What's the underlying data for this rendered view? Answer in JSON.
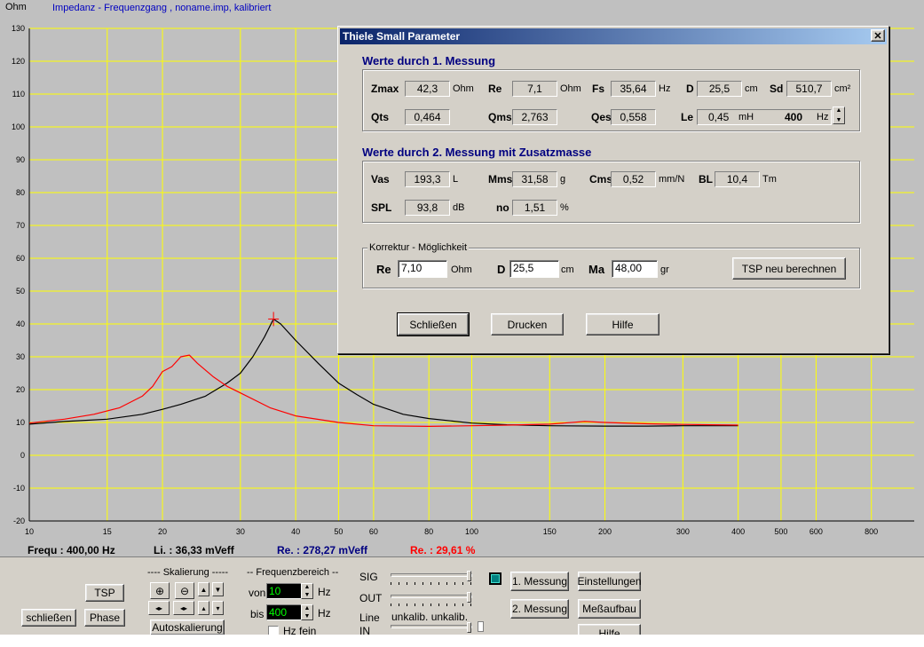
{
  "plot": {
    "y_unit": "Ohm",
    "title": "Impedanz - Frequenzgang , noname.imp, kalibriert",
    "y_ticks": [
      130,
      120,
      110,
      100,
      90,
      80,
      70,
      60,
      50,
      40,
      30,
      20,
      10,
      0,
      -10,
      -20
    ],
    "x_ticks": [
      10,
      15,
      20,
      30,
      40,
      50,
      60,
      80,
      100,
      150,
      200,
      300,
      400,
      500,
      600,
      800
    ],
    "colors": {
      "background": "#c0c0c0",
      "grid": "#ffff00",
      "axis": "#000000",
      "curve_black": "#000000",
      "curve_red": "#ff0000"
    }
  },
  "chart_data": {
    "type": "line",
    "x_scale": "log",
    "xlim": [
      10,
      1000
    ],
    "ylim": [
      -20,
      130
    ],
    "series": [
      {
        "color": "#000000",
        "x": [
          10,
          12,
          15,
          18,
          20,
          22,
          25,
          28,
          30,
          32,
          34,
          35.64,
          37,
          40,
          45,
          50,
          55,
          60,
          70,
          80,
          100,
          120,
          150,
          200,
          250,
          300,
          400
        ],
        "y": [
          9.5,
          10.3,
          11,
          12.5,
          14,
          15.5,
          18,
          22,
          25,
          30,
          36,
          41.5,
          40,
          35,
          28,
          22,
          18.5,
          15.5,
          12.5,
          11.2,
          9.8,
          9.3,
          9,
          8.9,
          8.9,
          9,
          9
        ]
      },
      {
        "color": "#ff0000",
        "x": [
          10,
          12,
          14,
          16,
          18,
          19,
          20,
          21,
          22,
          23,
          24,
          26,
          28,
          30,
          35,
          40,
          50,
          60,
          80,
          100,
          120,
          150,
          180,
          200,
          250,
          300,
          400
        ],
        "y": [
          9.8,
          11,
          12.5,
          14.5,
          18,
          21,
          25.5,
          27,
          30,
          30.5,
          28,
          24,
          21,
          19,
          14.5,
          12,
          10,
          9,
          8.8,
          9,
          9.2,
          9.5,
          10.3,
          10,
          9.6,
          9.4,
          9.2
        ]
      }
    ],
    "marker": {
      "x": 35.64,
      "y": 41.5
    }
  },
  "status": {
    "frequ": "Frequ : 400,00 Hz",
    "li": "Li. : 36,33 mVeff",
    "re_mveff": "Re. : 278,27 mVeff",
    "re_pct": "Re. : 29,61 %"
  },
  "dialog": {
    "title": "Thiele Small Parameter",
    "close_glyph": "✕",
    "section1": "Werte durch 1. Messung",
    "m1": {
      "zmax_label": "Zmax",
      "zmax": "42,3",
      "zmax_unit": "Ohm",
      "re_label": "Re",
      "re": "7,1",
      "re_unit": "Ohm",
      "fs_label": "Fs",
      "fs": "35,64",
      "fs_unit": "Hz",
      "d_label": "D",
      "d": "25,5",
      "d_unit": "cm",
      "sd_label": "Sd",
      "sd": "510,7",
      "sd_unit": "cm²",
      "qts_label": "Qts",
      "qts": "0,464",
      "qms_label": "Qms",
      "qms": "2,763",
      "qes_label": "Qes",
      "qes": "0,558",
      "le_label": "Le",
      "le": "0,45",
      "le_unit": "mH",
      "le_freq": "400",
      "le_freq_unit": "Hz"
    },
    "section2": "Werte durch 2. Messung mit Zusatzmasse",
    "m2": {
      "vas_label": "Vas",
      "vas": "193,3",
      "vas_unit": "L",
      "mms_label": "Mms",
      "mms": "31,58",
      "mms_unit": "g",
      "cms_label": "Cms",
      "cms": "0,52",
      "cms_unit": "mm/N",
      "bl_label": "BL",
      "bl": "10,4",
      "bl_unit": "Tm",
      "spl_label": "SPL",
      "spl": "93,8",
      "spl_unit": "dB",
      "no_label": "no",
      "no": "1,51",
      "no_unit": "%"
    },
    "korrektur": {
      "legend": "Korrektur - Möglichkeit",
      "re_label": "Re",
      "re": "7,10",
      "re_unit": "Ohm",
      "d_label": "D",
      "d": "25,5",
      "d_unit": "cm",
      "ma_label": "Ma",
      "ma": "48,00",
      "ma_unit": "gr",
      "recalc": "TSP neu berechnen"
    },
    "buttons": {
      "close": "Schließen",
      "print": "Drucken",
      "help": "Hilfe"
    }
  },
  "panel": {
    "tsp": "TSP",
    "schliessen": "schließen",
    "phase": "Phase",
    "skalierung": "---- Skalierung -----",
    "autoskalierung": "Autoskalierung",
    "frequenzbereich": "-- Frequenzbereich --",
    "von": "von",
    "von_value": "10",
    "bis": "bis",
    "bis_value": "400",
    "hz": "Hz",
    "hz_fein": "Hz fein",
    "sig": "SIG",
    "out": "OUT",
    "line": "Line",
    "in": "IN",
    "unkalib": "unkalib. unkalib.",
    "messung1": "1. Messung",
    "messung2": "2. Messung",
    "einstellungen": "Einstellungen",
    "messaufbau": "Meßaufbau",
    "hilfe": "Hilfe"
  }
}
